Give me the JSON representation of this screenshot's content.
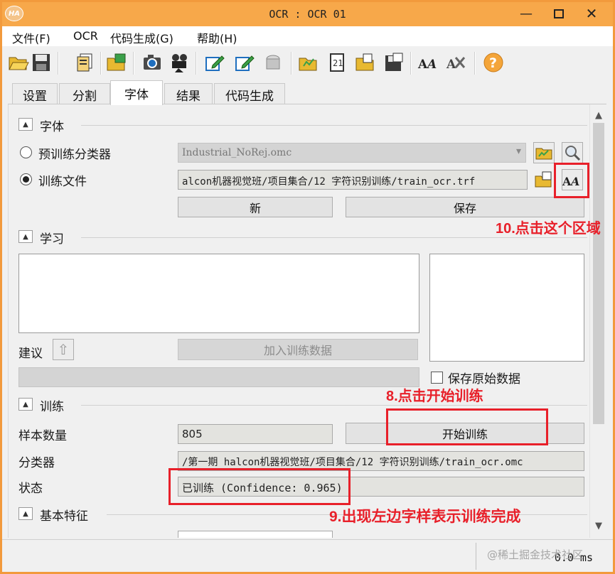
{
  "window": {
    "title": "OCR : OCR 01",
    "app_icon_text": "HA",
    "min_symbol": "—",
    "close_symbol": "✕"
  },
  "menu": [
    "文件(F)",
    "OCR",
    "代码生成(G)",
    "帮助(H)"
  ],
  "toolbar": {
    "icons": [
      "open-folder",
      "save-disk",
      "image-stack",
      "open-image",
      "camera",
      "film-projector",
      "pencil-box-blue",
      "pencil-box-green",
      "eraser",
      "open-train-file",
      "train-file-doc",
      "open-classifier",
      "save-classifier",
      "font-glyphs",
      "font-scissors",
      "help"
    ],
    "help_symbol": "?"
  },
  "tabs": [
    {
      "label": "设置",
      "active": false
    },
    {
      "label": "分割",
      "active": false
    },
    {
      "label": "字体",
      "active": true
    },
    {
      "label": "结果",
      "active": false
    },
    {
      "label": "代码生成",
      "active": false
    }
  ],
  "font_section": {
    "title": "字体",
    "toggle": "▲",
    "pretrained_label": "预训练分类器",
    "pretrained_value": "Industrial_NoRej.omc",
    "dropdown_arrow": "▾",
    "train_file_label": "训练文件",
    "train_file_value": "alcon机器视觉班/项目集合/12 字符识别训练/train_ocr.trf",
    "new_button": "新",
    "save_button": "保存",
    "font_glyph": "ÂÁ"
  },
  "learn_section": {
    "title": "学习",
    "suggest_label": "建议",
    "up_arrow": "⇧",
    "add_data_button": "加入训练数据",
    "save_raw_label": "保存原始数据"
  },
  "train_section": {
    "title": "训练",
    "sample_count_label": "样本数量",
    "sample_count_value": "805",
    "start_button": "开始训练",
    "classifier_label": "分类器",
    "classifier_value": "/第一期 halcon机器视觉班/项目集合/12 字符识别训练/train_ocr.omc",
    "status_label": "状态",
    "status_value": "已训练 (Confidence: 0.965)"
  },
  "feature_section": {
    "title": "基本特征"
  },
  "scrollbar": {
    "up": "▲",
    "down": "▼"
  },
  "statusbar": {
    "time": "0.0 ms",
    "watermark": "@稀土掘金技术社区"
  },
  "annotations": {
    "step8": "8.点击开始训练",
    "step9": "9.出现左边字样表示训练完成",
    "step10": "10.点击这个区域",
    "color": "#e8202a"
  },
  "colors": {
    "titlebar": "#f7a84a",
    "window_border": "#f29a3c"
  }
}
